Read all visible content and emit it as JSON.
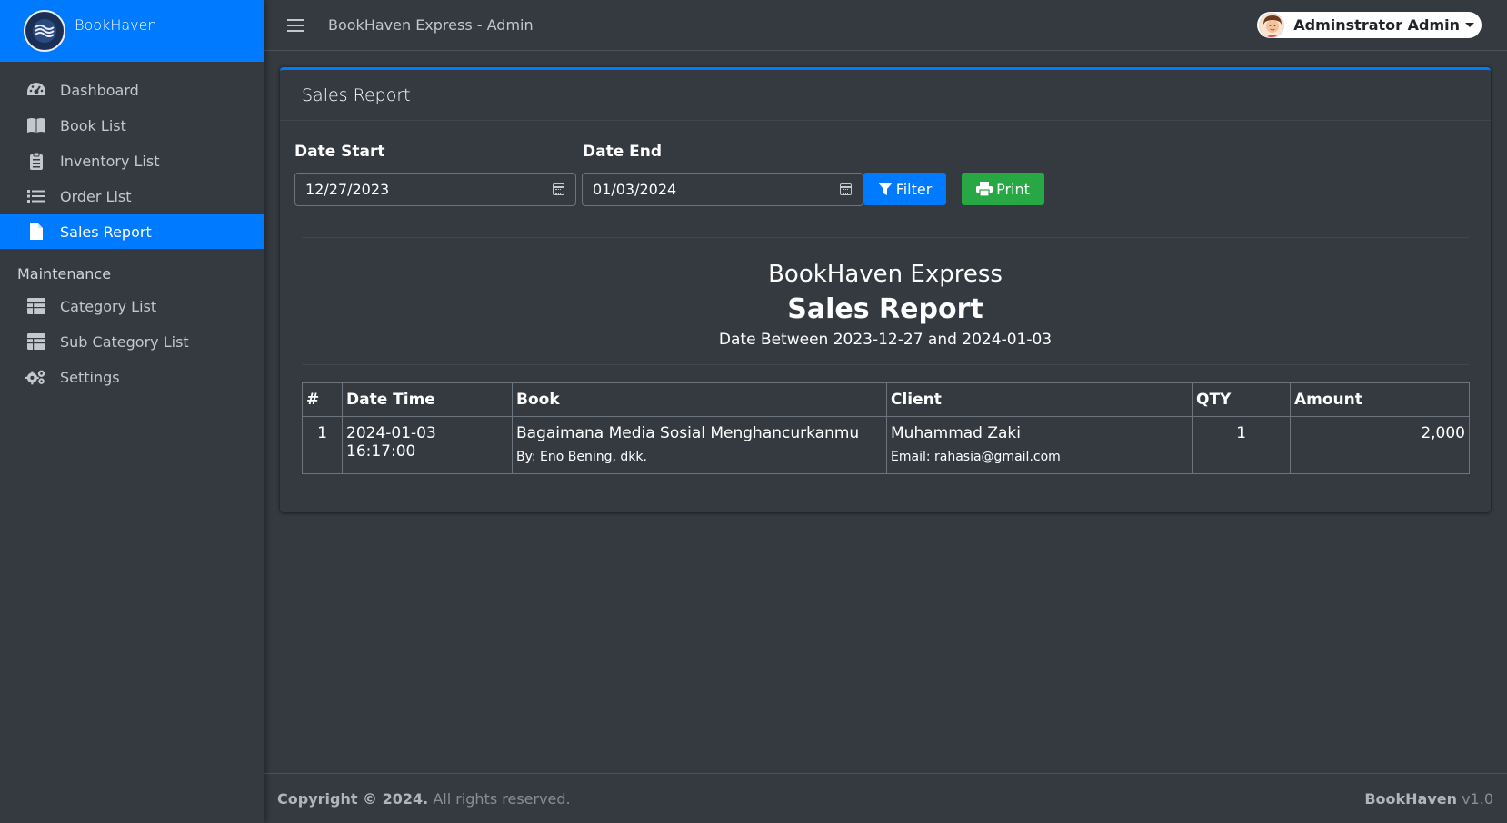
{
  "brand": {
    "name": "BookHaven"
  },
  "sidebar": {
    "items": [
      {
        "label": "Dashboard",
        "icon": "dashboard-icon"
      },
      {
        "label": "Book List",
        "icon": "book-open-icon"
      },
      {
        "label": "Inventory List",
        "icon": "clipboard-icon"
      },
      {
        "label": "Order List",
        "icon": "list-icon"
      },
      {
        "label": "Sales Report",
        "icon": "file-icon",
        "active": true
      }
    ],
    "section_header": "Maintenance",
    "maintenance_items": [
      {
        "label": "Category List",
        "icon": "table-icon"
      },
      {
        "label": "Sub Category List",
        "icon": "table-icon"
      },
      {
        "label": "Settings",
        "icon": "cogs-icon"
      }
    ]
  },
  "topbar": {
    "title": "BookHaven Express - Admin",
    "user_name": "Adminstrator Admin"
  },
  "card": {
    "title": "Sales Report",
    "date_start_label": "Date Start",
    "date_start_value": "12/27/2023",
    "date_end_label": "Date End",
    "date_end_value": "01/03/2024",
    "filter_label": "Filter",
    "print_label": "Print"
  },
  "report": {
    "company": "BookHaven Express",
    "title": "Sales Report",
    "range": "Date Between 2023-12-27 and 2024-01-03"
  },
  "table": {
    "headers": [
      "#",
      "Date Time",
      "Book",
      "Client",
      "QTY",
      "Amount"
    ],
    "rows": [
      {
        "num": "1",
        "datetime": "2024-01-03 16:17:00",
        "book": "Bagaimana Media Sosial Menghancurkanmu",
        "book_author": "By: Eno Bening, dkk.",
        "client": "Muhammad Zaki",
        "client_email": "Email: rahasia@gmail.com",
        "qty": "1",
        "amount": "2,000"
      }
    ]
  },
  "footer": {
    "copyright_bold": "Copyright © 2024.",
    "copyright_rest": " All rights reserved.",
    "app_name": "BookHaven",
    "version": " v1.0"
  },
  "colors": {
    "primary": "#007bff",
    "success": "#28a745",
    "background": "#343a40"
  }
}
